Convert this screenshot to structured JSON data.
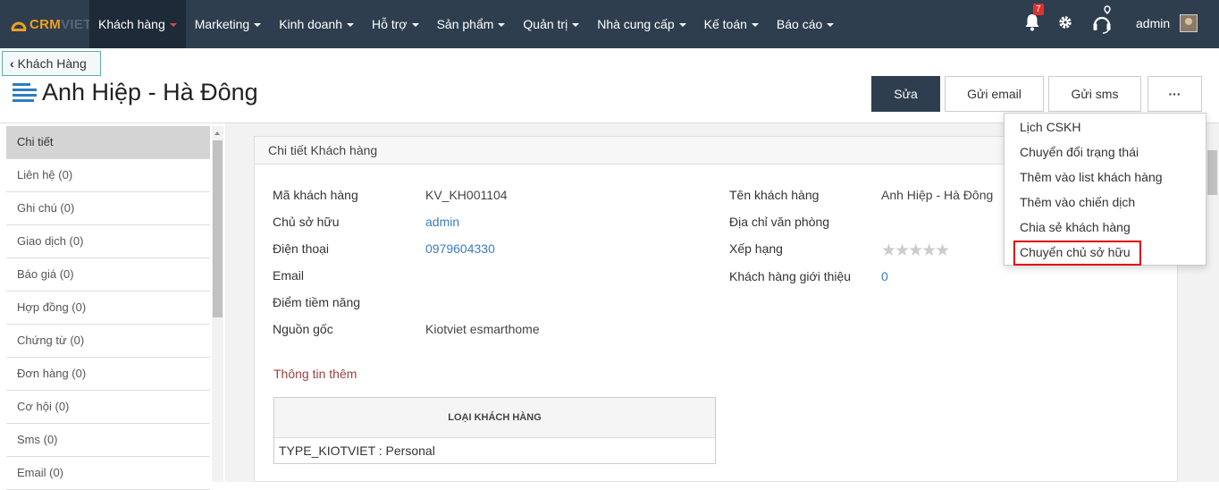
{
  "brand": {
    "logo_text": "CRM",
    "logo_text_suffix": "VIET"
  },
  "topnav": {
    "menu": [
      {
        "label": "Khách hàng",
        "active": true
      },
      {
        "label": "Marketing"
      },
      {
        "label": "Kinh doanh"
      },
      {
        "label": "Hỗ trợ"
      },
      {
        "label": "Sản phẩm"
      },
      {
        "label": "Quản trị"
      },
      {
        "label": "Nhà cung cấp"
      },
      {
        "label": "Kế toán"
      },
      {
        "label": "Báo cáo"
      }
    ],
    "notification_count": "7",
    "user_name": "admin",
    "icons": [
      "bell-icon",
      "gear-icon",
      "headset-icon"
    ]
  },
  "header": {
    "back_label": "Khách Hàng",
    "title": "Anh Hiệp - Hà Đông",
    "buttons": {
      "edit": "Sửa",
      "send_email": "Gửi email",
      "send_sms": "Gửi sms",
      "more": "···"
    }
  },
  "sidebar": {
    "items": [
      {
        "label": "Chi tiết",
        "active": true
      },
      {
        "label": "Liên hệ (0)"
      },
      {
        "label": "Ghi chú (0)"
      },
      {
        "label": "Giao dịch (0)"
      },
      {
        "label": "Báo giá (0)"
      },
      {
        "label": "Hợp đồng (0)"
      },
      {
        "label": "Chứng từ (0)"
      },
      {
        "label": "Đơn hàng (0)"
      },
      {
        "label": "Cơ hội (0)"
      },
      {
        "label": "Sms (0)"
      },
      {
        "label": "Email (0)"
      }
    ]
  },
  "detail": {
    "panel_title": "Chi tiết Khách hàng",
    "left_fields": [
      {
        "label": "Mã khách hàng",
        "value": "KV_KH001104"
      },
      {
        "label": "Chủ sở hữu",
        "value": "admin"
      },
      {
        "label": "Điện thoại",
        "value": "0979604330"
      },
      {
        "label": "Email",
        "value": ""
      },
      {
        "label": "Điểm tiềm năng",
        "value": ""
      },
      {
        "label": "Nguồn gốc",
        "value": "Kiotviet esmarthome"
      }
    ],
    "right_fields": [
      {
        "label": "Tên khách hàng",
        "value": "Anh Hiệp - Hà Đông"
      },
      {
        "label": "Địa chỉ văn phòng",
        "value": ""
      },
      {
        "label": "Xếp hạng",
        "value": "★★★★★",
        "rating": 0
      },
      {
        "label": "Khách hàng giới thiệu",
        "value": "0"
      }
    ],
    "more_info_title": "Thông tin thêm",
    "customer_type_table": {
      "header": "LOẠI KHÁCH HÀNG",
      "value": "TYPE_KIOTVIET : Personal"
    }
  },
  "dropdown": {
    "items": [
      "Lịch CSKH",
      "Chuyển đổi trạng thái",
      "Thêm vào list khách hàng",
      "Thêm vào chiến dịch",
      "Chia sẻ khách hàng",
      "Chuyển chủ sở hữu"
    ],
    "highlighted_index": 5
  },
  "colors": {
    "nav_bg": "#2e3e4e",
    "accent_blue": "#2c7dc0",
    "link": "#3a7cc2",
    "highlight_border": "#e00000",
    "more_info_text": "#a04040"
  }
}
